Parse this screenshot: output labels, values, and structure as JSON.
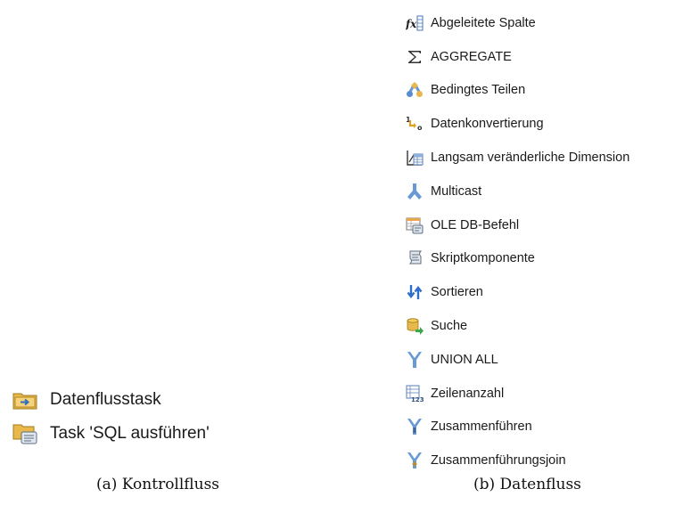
{
  "kontrollfluss": {
    "caption": "(a) Kontrollfluss",
    "items": [
      {
        "label": "Datenflusstask",
        "icon": "data-flow-task-icon"
      },
      {
        "label": "Task 'SQL ausführen'",
        "icon": "execute-sql-task-icon"
      }
    ]
  },
  "datenfluss": {
    "caption": "(b) Datenfluss",
    "items": [
      {
        "label": "Abgeleitete Spalte",
        "icon": "derived-column-icon"
      },
      {
        "label": "AGGREGATE",
        "icon": "sigma-icon"
      },
      {
        "label": "Bedingtes Teilen",
        "icon": "conditional-split-icon"
      },
      {
        "label": "Datenkonvertierung",
        "icon": "data-conversion-icon"
      },
      {
        "label": "Langsam veränderliche Dimension",
        "icon": "slowly-changing-dimension-icon"
      },
      {
        "label": "Multicast",
        "icon": "multicast-icon"
      },
      {
        "label": "OLE DB-Befehl",
        "icon": "ole-db-command-icon"
      },
      {
        "label": "Skriptkomponente",
        "icon": "script-component-icon"
      },
      {
        "label": "Sortieren",
        "icon": "sort-icon"
      },
      {
        "label": "Suche",
        "icon": "lookup-icon"
      },
      {
        "label": "UNION ALL",
        "icon": "union-all-icon"
      },
      {
        "label": "Zeilenanzahl",
        "icon": "row-count-icon"
      },
      {
        "label": "Zusammenführen",
        "icon": "merge-icon"
      },
      {
        "label": "Zusammenführungsjoin",
        "icon": "merge-join-icon"
      }
    ]
  }
}
